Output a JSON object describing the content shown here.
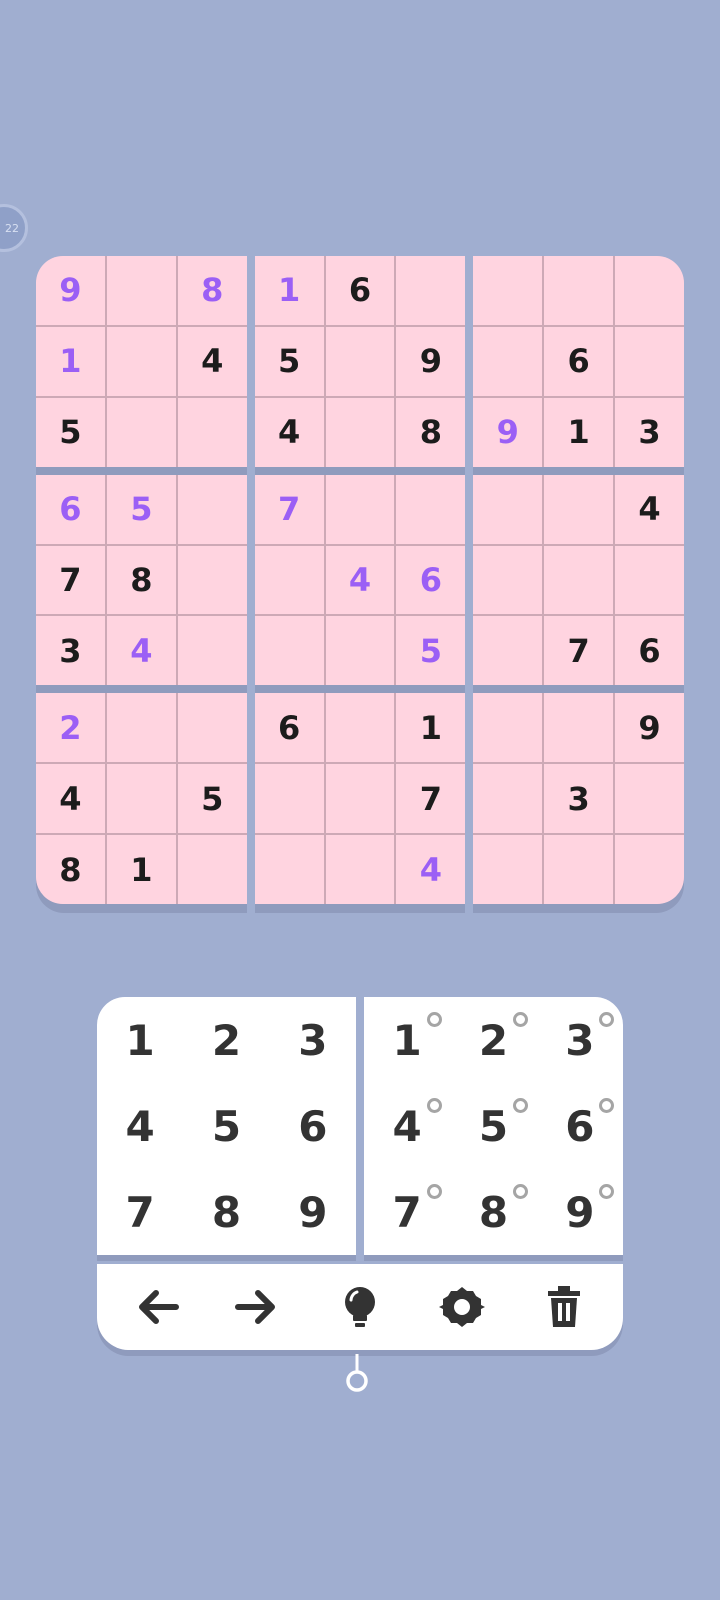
{
  "timer_badge": "22",
  "board": {
    "cells": [
      [
        {
          "v": "9",
          "t": "user"
        },
        {
          "v": "",
          "t": ""
        },
        {
          "v": "8",
          "t": "user"
        },
        {
          "v": "1",
          "t": "user"
        },
        {
          "v": "6",
          "t": "given"
        },
        {
          "v": "",
          "t": ""
        },
        {
          "v": "",
          "t": ""
        },
        {
          "v": "",
          "t": ""
        },
        {
          "v": "",
          "t": ""
        }
      ],
      [
        {
          "v": "1",
          "t": "user"
        },
        {
          "v": "",
          "t": ""
        },
        {
          "v": "4",
          "t": "given"
        },
        {
          "v": "5",
          "t": "given"
        },
        {
          "v": "",
          "t": ""
        },
        {
          "v": "9",
          "t": "given"
        },
        {
          "v": "",
          "t": ""
        },
        {
          "v": "6",
          "t": "given"
        },
        {
          "v": "",
          "t": ""
        }
      ],
      [
        {
          "v": "5",
          "t": "given"
        },
        {
          "v": "",
          "t": ""
        },
        {
          "v": "",
          "t": ""
        },
        {
          "v": "4",
          "t": "given"
        },
        {
          "v": "",
          "t": ""
        },
        {
          "v": "8",
          "t": "given"
        },
        {
          "v": "9",
          "t": "user"
        },
        {
          "v": "1",
          "t": "given"
        },
        {
          "v": "3",
          "t": "given"
        }
      ],
      [
        {
          "v": "6",
          "t": "user"
        },
        {
          "v": "5",
          "t": "user"
        },
        {
          "v": "",
          "t": ""
        },
        {
          "v": "7",
          "t": "user"
        },
        {
          "v": "",
          "t": ""
        },
        {
          "v": "",
          "t": ""
        },
        {
          "v": "",
          "t": ""
        },
        {
          "v": "",
          "t": ""
        },
        {
          "v": "4",
          "t": "given"
        }
      ],
      [
        {
          "v": "7",
          "t": "given"
        },
        {
          "v": "8",
          "t": "given"
        },
        {
          "v": "",
          "t": ""
        },
        {
          "v": "",
          "t": ""
        },
        {
          "v": "4",
          "t": "user"
        },
        {
          "v": "6",
          "t": "user"
        },
        {
          "v": "",
          "t": ""
        },
        {
          "v": "",
          "t": ""
        },
        {
          "v": "",
          "t": ""
        }
      ],
      [
        {
          "v": "3",
          "t": "given"
        },
        {
          "v": "4",
          "t": "user"
        },
        {
          "v": "",
          "t": ""
        },
        {
          "v": "",
          "t": ""
        },
        {
          "v": "",
          "t": ""
        },
        {
          "v": "5",
          "t": "user"
        },
        {
          "v": "",
          "t": ""
        },
        {
          "v": "7",
          "t": "given"
        },
        {
          "v": "6",
          "t": "given"
        }
      ],
      [
        {
          "v": "2",
          "t": "user"
        },
        {
          "v": "",
          "t": ""
        },
        {
          "v": "",
          "t": ""
        },
        {
          "v": "6",
          "t": "given"
        },
        {
          "v": "",
          "t": ""
        },
        {
          "v": "1",
          "t": "given"
        },
        {
          "v": "",
          "t": ""
        },
        {
          "v": "",
          "t": ""
        },
        {
          "v": "9",
          "t": "given"
        }
      ],
      [
        {
          "v": "4",
          "t": "given"
        },
        {
          "v": "",
          "t": ""
        },
        {
          "v": "5",
          "t": "given"
        },
        {
          "v": "",
          "t": ""
        },
        {
          "v": "",
          "t": ""
        },
        {
          "v": "7",
          "t": "given"
        },
        {
          "v": "",
          "t": ""
        },
        {
          "v": "3",
          "t": "given"
        },
        {
          "v": "",
          "t": ""
        }
      ],
      [
        {
          "v": "8",
          "t": "given"
        },
        {
          "v": "1",
          "t": "given"
        },
        {
          "v": "",
          "t": ""
        },
        {
          "v": "",
          "t": ""
        },
        {
          "v": "",
          "t": ""
        },
        {
          "v": "4",
          "t": "user"
        },
        {
          "v": "",
          "t": ""
        },
        {
          "v": "",
          "t": ""
        },
        {
          "v": "",
          "t": ""
        }
      ]
    ]
  },
  "keypad": {
    "digits": [
      "1",
      "2",
      "3",
      "4",
      "5",
      "6",
      "7",
      "8",
      "9"
    ],
    "notes": [
      "1",
      "2",
      "3",
      "4",
      "5",
      "6",
      "7",
      "8",
      "9"
    ]
  },
  "toolbar": {
    "tools": [
      {
        "name": "undo-button",
        "icon": "arrow-left-icon"
      },
      {
        "name": "redo-button",
        "icon": "arrow-right-icon"
      },
      {
        "name": "hint-button",
        "icon": "lightbulb-icon"
      },
      {
        "name": "settings-button",
        "icon": "gear-icon"
      },
      {
        "name": "delete-button",
        "icon": "trash-icon"
      }
    ]
  },
  "colors": {
    "background": "#a0aed0",
    "cell": "#ffd4e0",
    "grid_line": "#cda9b6",
    "given_digit": "#1c1c1c",
    "user_digit": "#9b5ff5",
    "pad": "#ffffff",
    "pad_digit": "#333333"
  }
}
